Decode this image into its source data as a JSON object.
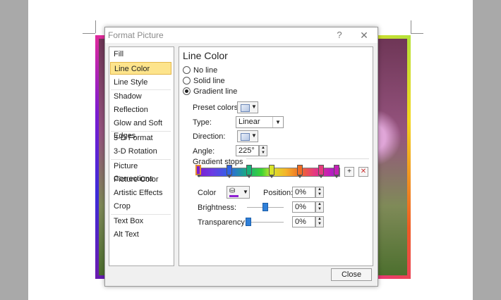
{
  "dialog": {
    "title": "Format Picture",
    "help_icon": "?",
    "close_icon": "✕"
  },
  "nav": {
    "items": [
      {
        "label": "Fill",
        "selected": false
      },
      {
        "label": "Line Color",
        "selected": true
      },
      {
        "label": "Line Style",
        "selected": false
      },
      {
        "label": "Shadow",
        "selected": false
      },
      {
        "label": "Reflection",
        "selected": false
      },
      {
        "label": "Glow and Soft Edges",
        "selected": false
      },
      {
        "label": "3-D Format",
        "selected": false
      },
      {
        "label": "3-D Rotation",
        "selected": false
      },
      {
        "label": "Picture Corrections",
        "selected": false
      },
      {
        "label": "Picture Color",
        "selected": false
      },
      {
        "label": "Artistic Effects",
        "selected": false
      },
      {
        "label": "Crop",
        "selected": false
      },
      {
        "label": "Text Box",
        "selected": false
      },
      {
        "label": "Alt Text",
        "selected": false
      }
    ]
  },
  "panel": {
    "title": "Line Color",
    "options": [
      {
        "label": "No line",
        "checked": false
      },
      {
        "label": "Solid line",
        "checked": false
      },
      {
        "label": "Gradient line",
        "checked": true
      }
    ],
    "preset_colors_label": "Preset colors:",
    "type_label": "Type:",
    "type_value": "Linear",
    "direction_label": "Direction:",
    "angle_label": "Angle:",
    "angle_value": "225°",
    "gradient_stops_label": "Gradient stops",
    "stops": [
      {
        "position": 0.0,
        "color": "#7d1ed0",
        "active": true
      },
      {
        "position": 0.22,
        "color": "#2f64e6",
        "active": false
      },
      {
        "position": 0.36,
        "color": "#18b07a",
        "active": false
      },
      {
        "position": 0.52,
        "color": "#d8e42a",
        "active": false
      },
      {
        "position": 0.72,
        "color": "#f06d24",
        "active": false
      },
      {
        "position": 0.87,
        "color": "#e63a7f",
        "active": false
      },
      {
        "position": 0.98,
        "color": "#c41fb5",
        "active": false
      }
    ],
    "color_label": "Color",
    "color_swatch": "#8e1fd2",
    "position_label": "Position:",
    "position_value": "0%",
    "brightness_label": "Brightness:",
    "brightness_value": "0%",
    "brightness_level": 0.5,
    "transparency_label": "Transparency:",
    "transparency_value": "0%",
    "transparency_level": 0.0
  },
  "footer": {
    "close_label": "Close"
  },
  "colors": {
    "selected_nav_bg": "#fde48c",
    "selected_nav_border": "#e3b64a",
    "slider_thumb": "#2f7fd8"
  }
}
